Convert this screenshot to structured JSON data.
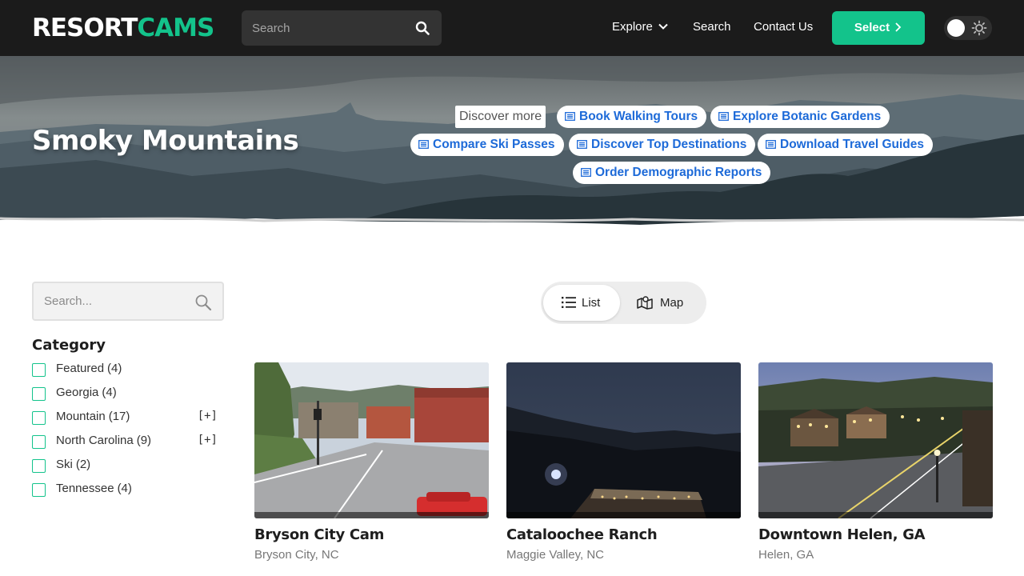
{
  "header": {
    "logo_part1": "RESORT",
    "logo_part2": "CAMS",
    "search_placeholder": "Search",
    "nav": {
      "explore": "Explore",
      "search": "Search",
      "contact": "Contact Us"
    },
    "select_label": "Select",
    "theme_toggle": "light"
  },
  "hero": {
    "title": "Smoky Mountains",
    "discover_label": "Discover more",
    "chips": [
      "Book Walking Tours",
      "Explore Botanic Gardens",
      "Compare Ski Passes",
      "Discover Top Destinations",
      "Download Travel Guides",
      "Order Demographic Reports"
    ]
  },
  "sidebar": {
    "search_placeholder": "Search...",
    "category_title": "Category",
    "categories": [
      {
        "label": "Featured",
        "count": "(4)",
        "expand": ""
      },
      {
        "label": "Georgia",
        "count": "(4)",
        "expand": ""
      },
      {
        "label": "Mountain",
        "count": "(17)",
        "expand": "[+]"
      },
      {
        "label": "North Carolina",
        "count": "(9)",
        "expand": "[+]"
      },
      {
        "label": "Ski",
        "count": "(2)",
        "expand": ""
      },
      {
        "label": "Tennessee",
        "count": "(4)",
        "expand": ""
      }
    ]
  },
  "view_toggle": {
    "list": "List",
    "map": "Map",
    "active": "list"
  },
  "cams": [
    {
      "name": "Bryson City Cam",
      "location": "Bryson City, NC"
    },
    {
      "name": "Cataloochee Ranch",
      "location": "Maggie Valley, NC"
    },
    {
      "name": "Downtown Helen, GA",
      "location": "Helen, GA"
    }
  ],
  "colors": {
    "accent": "#13c38b",
    "topbar": "#1b1b1b",
    "chip_text": "#1d6ad8"
  }
}
